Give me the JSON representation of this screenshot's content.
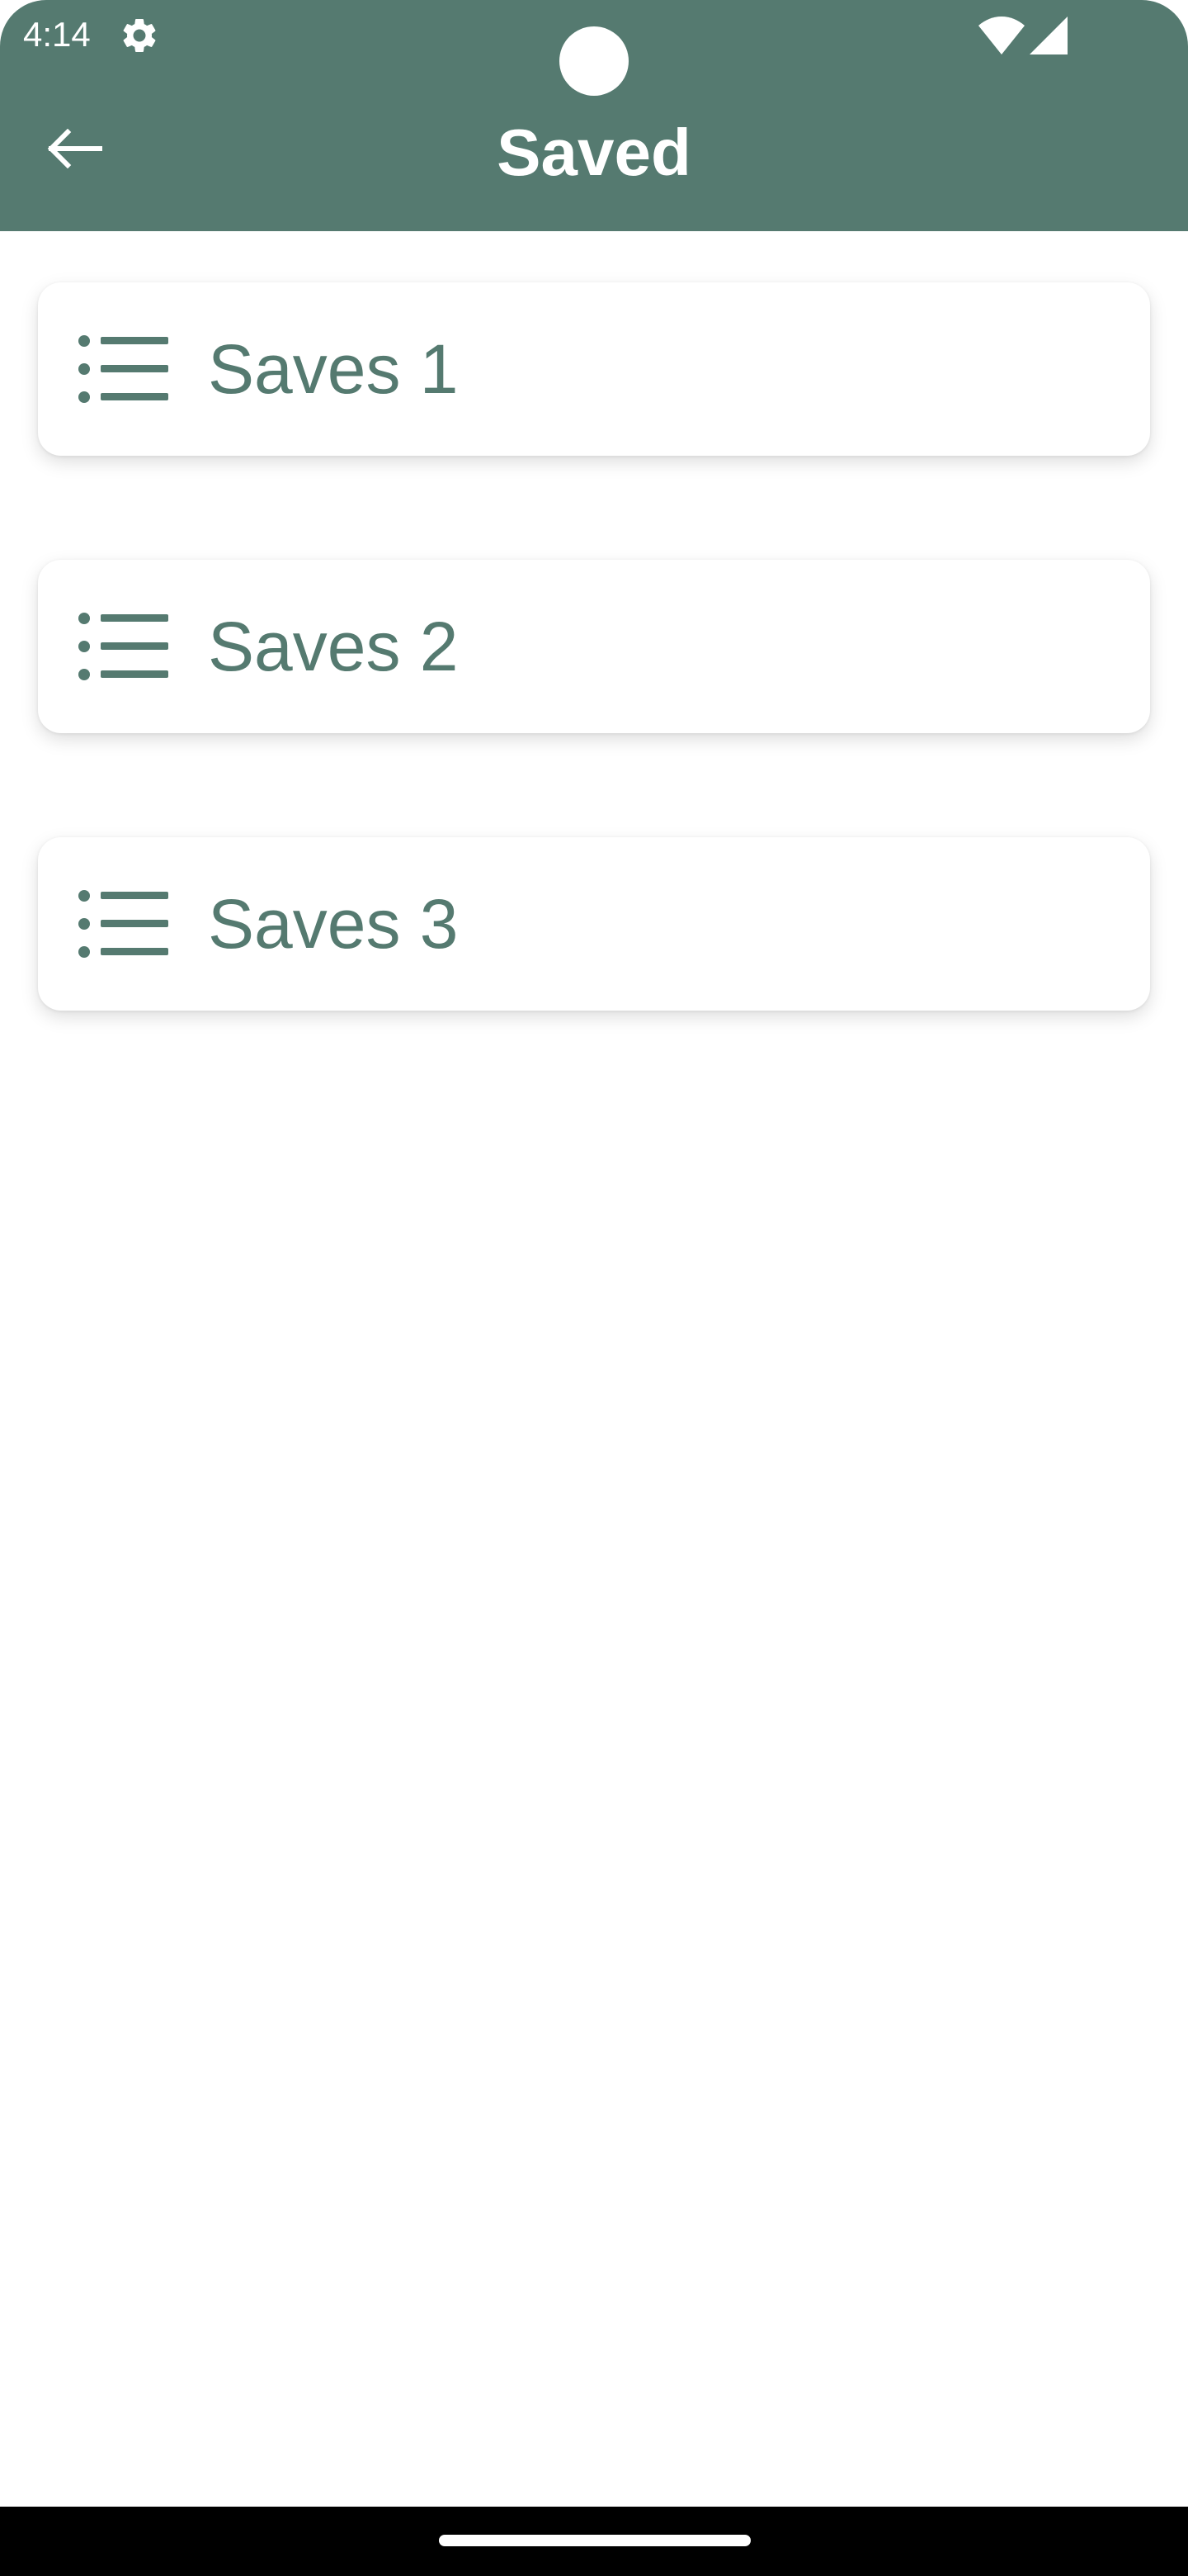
{
  "status_bar": {
    "time": "4:14",
    "icons": [
      "gear-icon",
      "wifi-icon",
      "signal-icon"
    ]
  },
  "app_bar": {
    "title": "Saved",
    "back_icon": "arrow-left-icon"
  },
  "saves": {
    "items": [
      {
        "label": "Saves 1",
        "icon": "list-icon"
      },
      {
        "label": "Saves 2",
        "icon": "list-icon"
      },
      {
        "label": "Saves 3",
        "icon": "list-icon"
      }
    ]
  },
  "colors": {
    "primary": "#557A70",
    "background": "#FFFFFF",
    "on_primary": "#FFFFFF",
    "nav_bar": "#000000"
  }
}
